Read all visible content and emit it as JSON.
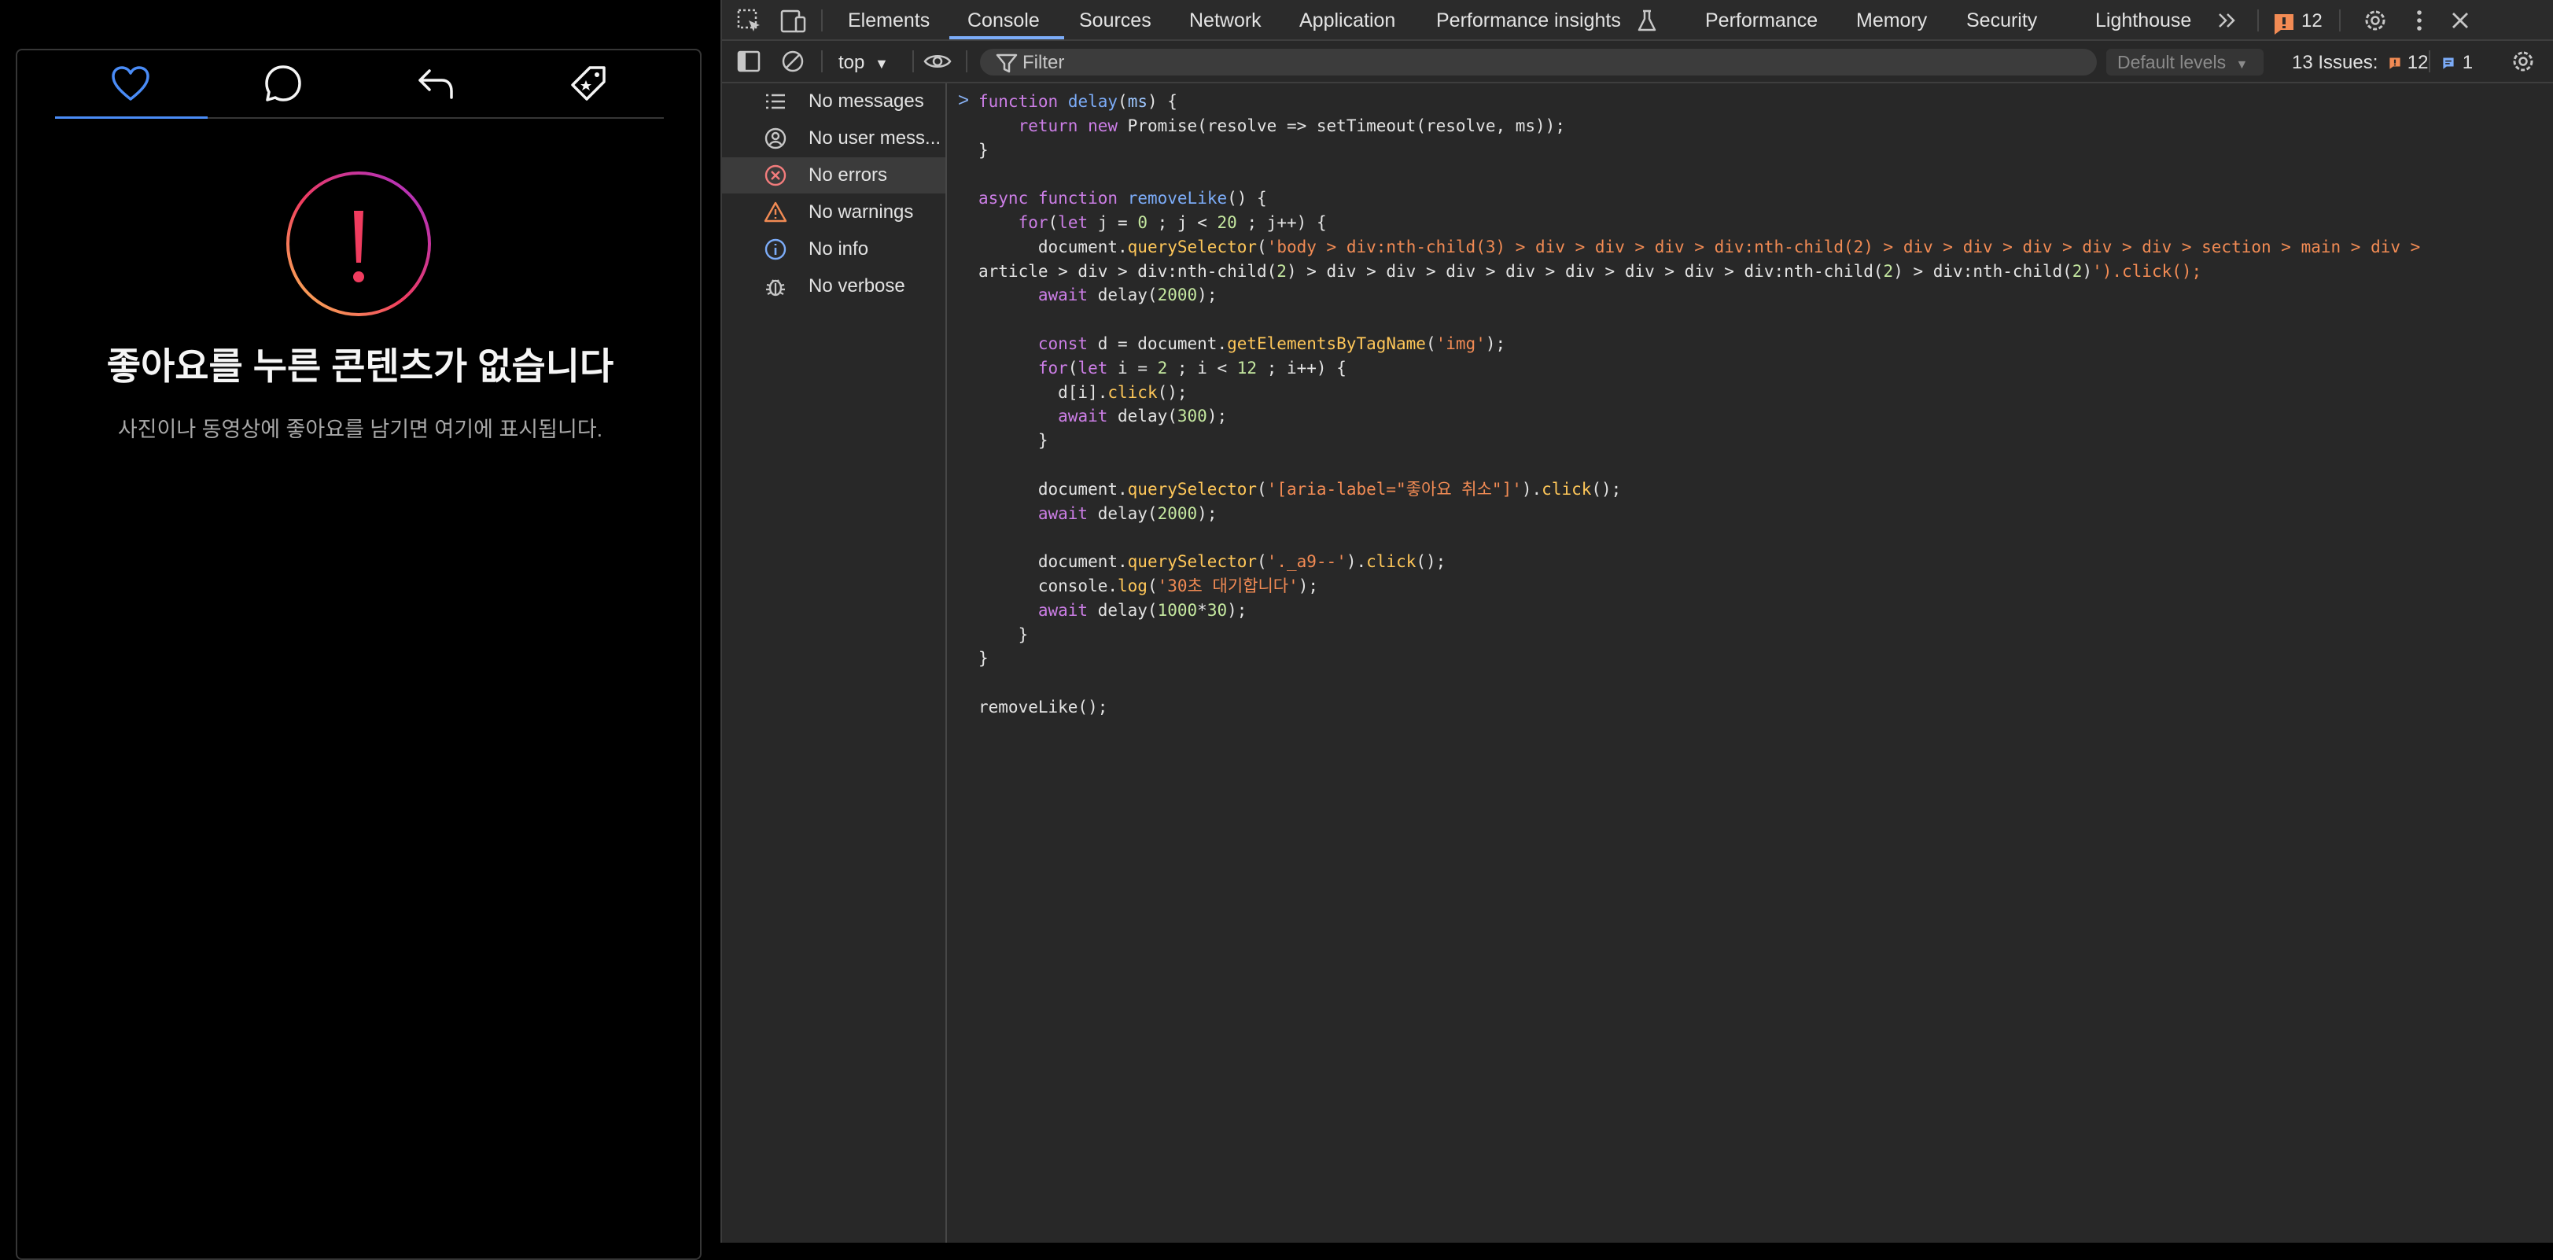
{
  "app": {
    "tabs": [
      {
        "name": "liked",
        "icon": "heart-icon"
      },
      {
        "name": "comments",
        "icon": "comment-icon"
      },
      {
        "name": "replies",
        "icon": "reply-icon"
      },
      {
        "name": "tags",
        "icon": "tag-icon"
      }
    ],
    "empty_title": "좋아요를 누른 콘텐츠가 없습니다",
    "empty_subtitle": "사진이나 동영상에 좋아요를 남기면 여기에 표시됩니다."
  },
  "devtools": {
    "tabs": [
      "Elements",
      "Console",
      "Sources",
      "Network",
      "Application",
      "Performance insights",
      "Performance",
      "Memory",
      "Security",
      "Lighthouse"
    ],
    "active_tab": "Console",
    "issues_badge": "12",
    "context": "top",
    "filter_placeholder": "Filter",
    "levels": "Default levels",
    "issues_label": "13 Issues:",
    "issues_warn": "12",
    "issues_info": "1",
    "sidebar": [
      "No messages",
      "No user mess...",
      "No errors",
      "No warnings",
      "No info",
      "No verbose"
    ],
    "sidebar_selected": "No errors",
    "code_lines": [
      "function delay(ms) {",
      "    return new Promise(resolve => setTimeout(resolve, ms));",
      "}",
      "",
      "async function removeLike() {",
      "    for(let j = 0 ; j < 20 ; j++) {",
      "      document.querySelector('body > div:nth-child(3) > div > div > div > div:nth-child(2) > div > div > div > div > div > section > main > div >",
      "article > div > div:nth-child(2) > div > div > div > div > div > div > div > div:nth-child(2) > div:nth-child(2)').click();",
      "      await delay(2000);",
      "",
      "      const d = document.getElementsByTagName('img');",
      "      for(let i = 2 ; i < 12 ; i++) {",
      "        d[i].click();",
      "        await delay(300);",
      "      }",
      "",
      "      document.querySelector('[aria-label=\"좋아요 취소\"]').click();",
      "      await delay(2000);",
      "",
      "      document.querySelector('._a9--').click();",
      "      console.log('30초 대기합니다');",
      "      await delay(1000*30);",
      "    }",
      "}",
      "",
      "removeLike();"
    ]
  }
}
